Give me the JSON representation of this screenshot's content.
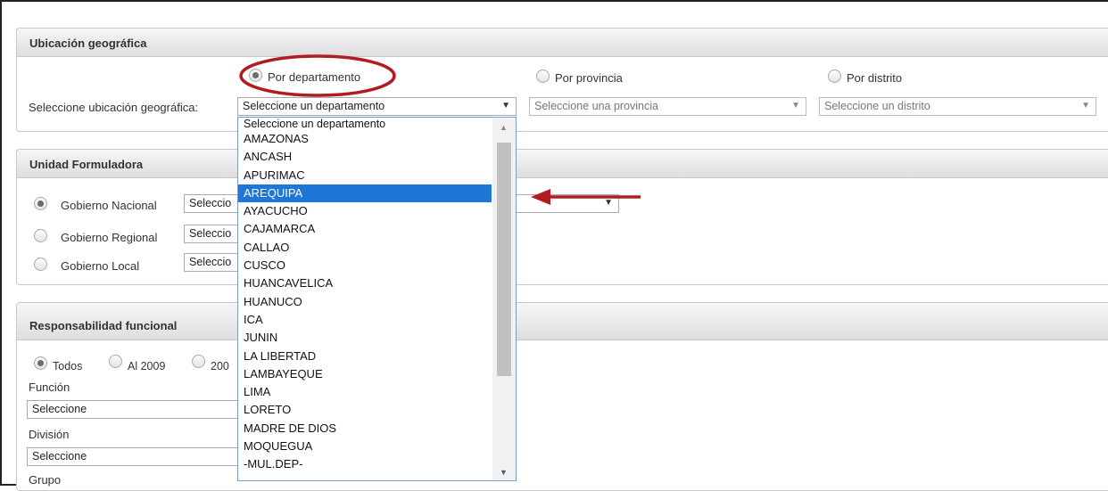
{
  "ubicacion": {
    "title": "Ubicación geográfica",
    "options": [
      "Por departamento",
      "Por provincia",
      "Por distrito"
    ],
    "label": "Seleccione ubicación geográfica:",
    "departamento_value": "Seleccione un departamento",
    "provincia_placeholder": "Seleccione una provincia",
    "distrito_placeholder": "Seleccione un distrito"
  },
  "dropdown": {
    "items": [
      "Seleccione un departamento",
      "AMAZONAS",
      "ANCASH",
      "APURIMAC",
      "AREQUIPA",
      "AYACUCHO",
      "CAJAMARCA",
      "CALLAO",
      "CUSCO",
      "HUANCAVELICA",
      "HUANUCO",
      "ICA",
      "JUNIN",
      "LA LIBERTAD",
      "LAMBAYEQUE",
      "LIMA",
      "LORETO",
      "MADRE DE DIOS",
      "MOQUEGUA",
      "-MUL.DEP-"
    ],
    "highlighted": "AREQUIPA"
  },
  "unidad": {
    "title": "Unidad Formuladora",
    "options": [
      "Gobierno Nacional",
      "Gobierno Regional",
      "Gobierno Local"
    ],
    "select_value": "Seleccio"
  },
  "responsabilidad": {
    "title": "Responsabilidad funcional",
    "radio_todos": "Todos",
    "radio_2009": "Al 2009",
    "radio_partial": "200",
    "funcion_label": "Función",
    "funcion_value": "Seleccione",
    "division_label": "División",
    "division_value": "Seleccione",
    "grupo_label": "Grupo"
  },
  "colors": {
    "annotation": "#b01c20",
    "highlight": "#1e76d7"
  }
}
